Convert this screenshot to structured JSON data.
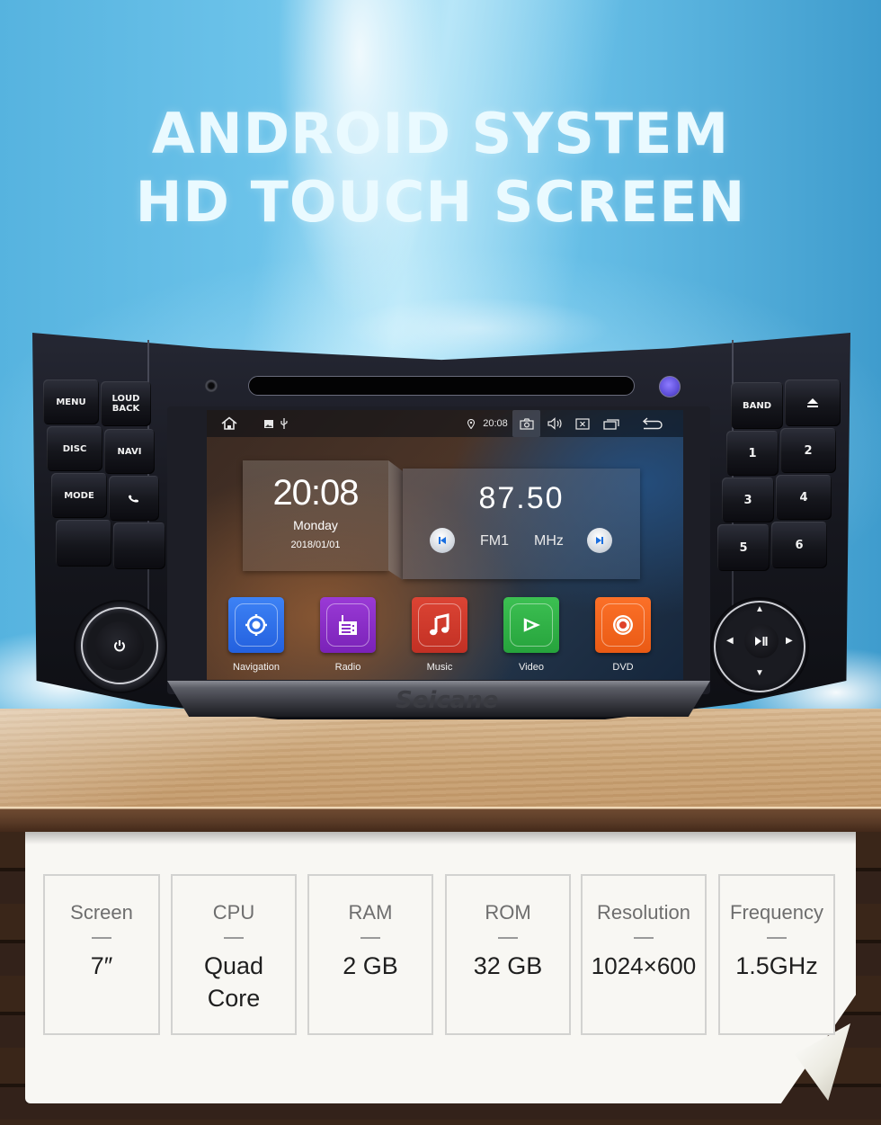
{
  "headline": {
    "line1": "ANDROID SYSTEM",
    "line2": "HD TOUCH SCREEN"
  },
  "colors": {
    "sky_accent": "#6cc3ea",
    "headline_text": "#eafaff",
    "navigation_tile": "#2b6de8",
    "radio_tile": "#8a2fc8",
    "music_tile": "#cf3a2e",
    "video_tile": "#2fb246",
    "dvd_tile": "#f2661e",
    "led_purple": "#6a58e6",
    "paper": "#f8f7f3"
  },
  "head_unit": {
    "brand": "Seicane",
    "left_buttons": [
      {
        "label": "MENU"
      },
      {
        "label": "LOUD BACK"
      },
      {
        "label": "DISC"
      },
      {
        "label": "NAVI"
      },
      {
        "label": "MODE"
      },
      {
        "label": "phone-icon",
        "icon": "phone"
      },
      {
        "label": ""
      },
      {
        "label": ""
      }
    ],
    "right_buttons": [
      {
        "label": "BAND"
      },
      {
        "label": "eject-icon",
        "icon": "eject"
      },
      {
        "label": "1"
      },
      {
        "label": "2"
      },
      {
        "label": "3"
      },
      {
        "label": "4"
      },
      {
        "label": "5"
      },
      {
        "label": "6"
      }
    ],
    "power_knob_icon": "power-icon",
    "dpad_center_icon": "play-pause-icon"
  },
  "screen": {
    "status_bar": {
      "time": "20:08",
      "icons": [
        "home-icon",
        "image-icon",
        "usb-icon",
        "location-icon",
        "camera-icon",
        "volume-icon",
        "close-box-icon",
        "recent-apps-icon",
        "back-icon"
      ]
    },
    "clock_widget": {
      "time": "20:08",
      "day": "Monday",
      "date": "2018/01/01"
    },
    "radio_widget": {
      "frequency": "87.50",
      "band": "FM1",
      "unit": "MHz"
    },
    "apps": [
      {
        "label": "Navigation",
        "icon": "navigation-icon",
        "color": "#2b6de8"
      },
      {
        "label": "Radio",
        "icon": "radio-icon",
        "color": "#8a2fc8"
      },
      {
        "label": "Music",
        "icon": "music-note-icon",
        "color": "#cf3a2e"
      },
      {
        "label": "Video",
        "icon": "video-play-icon",
        "color": "#2fb246"
      },
      {
        "label": "DVD",
        "icon": "disc-icon",
        "color": "#f2661e"
      }
    ]
  },
  "specs": [
    {
      "label": "Screen",
      "value": "7″"
    },
    {
      "label": "CPU",
      "value": "Quad Core"
    },
    {
      "label": "RAM",
      "value": "2 GB"
    },
    {
      "label": "ROM",
      "value": "32 GB"
    },
    {
      "label": "Resolution",
      "value": "1024×600"
    },
    {
      "label": "Frequency",
      "value": "1.5GHz"
    }
  ]
}
